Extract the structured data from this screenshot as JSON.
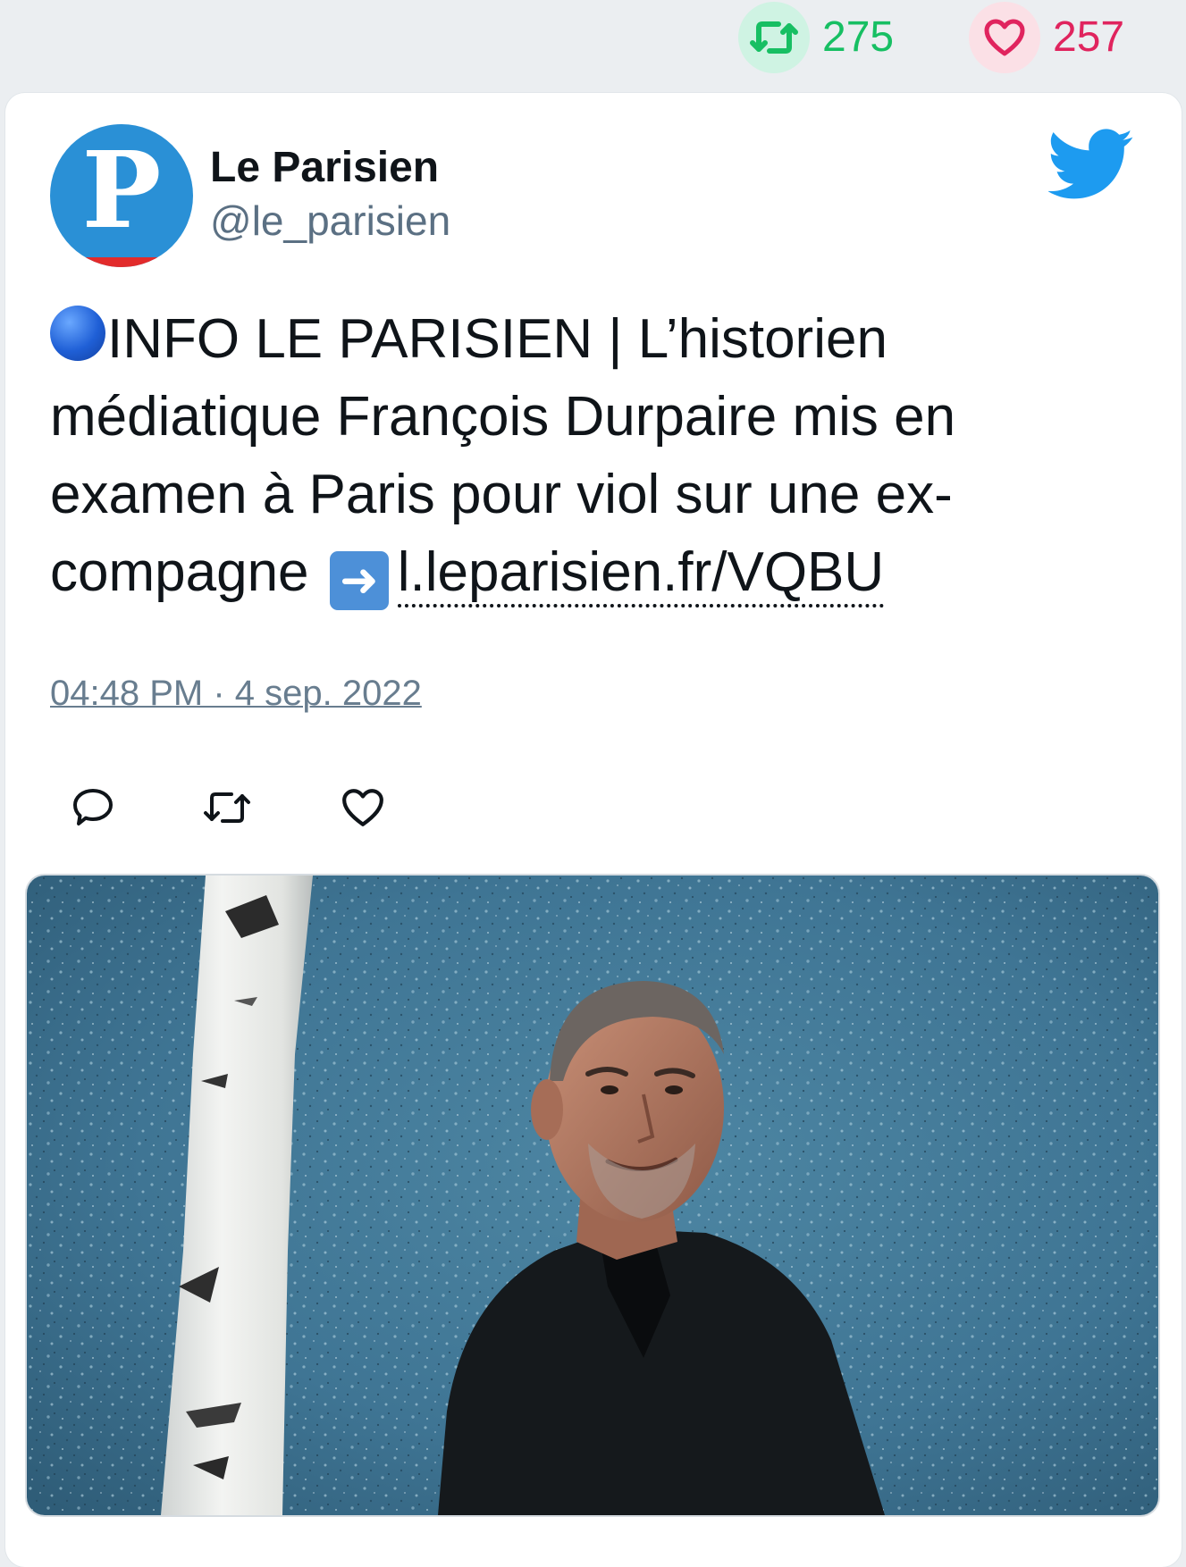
{
  "stats": {
    "retweets": "275",
    "likes": "257"
  },
  "author": {
    "name": "Le Parisien",
    "handle": "@le_parisien",
    "avatar_letter": "P"
  },
  "tweet": {
    "text_main": "INFO LE PARISIEN | L’historien médiatique François Durpaire mis en examen à Paris pour viol sur une ex-compagne",
    "link_text": "l.leparisien.fr/VQBU",
    "timestamp": "04:48 PM · 4 sep. 2022",
    "emoji_lead": "blue-circle-emoji",
    "emoji_arrow": "right-arrow-emoji"
  },
  "icons": {
    "retweet": "retweet-icon",
    "like": "heart-icon",
    "reply": "reply-icon",
    "brand": "twitter-bird-icon"
  },
  "colors": {
    "retweet_green": "#17bf63",
    "like_red": "#e0245e",
    "twitter_blue": "#1d9bf0",
    "avatar_blue": "#2a90d6",
    "muted_text": "#5b7083"
  }
}
